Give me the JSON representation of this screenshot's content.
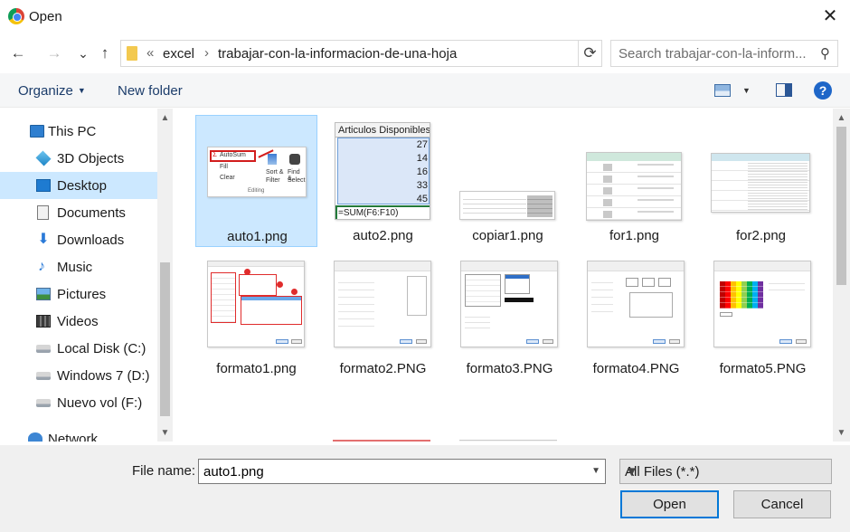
{
  "window": {
    "title": "Open",
    "close_glyph": "✕"
  },
  "nav_buttons": {
    "back": "←",
    "forward": "→",
    "recent": "⌄",
    "up": "↑"
  },
  "address": {
    "overflow": "«",
    "separator": "›",
    "crumbs": [
      "excel",
      "trabajar-con-la-informacion-de-una-hoja"
    ],
    "refresh_glyph": "⟳"
  },
  "search": {
    "placeholder": "Search trabajar-con-la-inform...",
    "icon_glyph": "⚲"
  },
  "toolbar": {
    "organize": "Organize",
    "caret": "▼",
    "new_folder": "New folder",
    "view_caret": "▼",
    "help": "?"
  },
  "sidebar": {
    "items": [
      {
        "label": "This PC",
        "icon": "computer-icon"
      },
      {
        "label": "3D Objects",
        "icon": "3d-objects-icon"
      },
      {
        "label": "Desktop",
        "icon": "desktop-icon",
        "selected": true
      },
      {
        "label": "Documents",
        "icon": "documents-icon"
      },
      {
        "label": "Downloads",
        "icon": "downloads-icon"
      },
      {
        "label": "Music",
        "icon": "music-icon"
      },
      {
        "label": "Pictures",
        "icon": "pictures-icon"
      },
      {
        "label": "Videos",
        "icon": "videos-icon"
      },
      {
        "label": "Local Disk (C:)",
        "icon": "drive-icon"
      },
      {
        "label": "Windows 7 (D:)",
        "icon": "drive-icon"
      },
      {
        "label": "Nuevo vol (F:)",
        "icon": "drive-icon"
      },
      {
        "label": "Network",
        "icon": "network-icon"
      }
    ],
    "down_glyph": "⬇",
    "music_glyph": "♪"
  },
  "scroll": {
    "up": "▲",
    "down": "▼"
  },
  "files": [
    {
      "name": "auto1.png",
      "selected": true
    },
    {
      "name": "auto2.png"
    },
    {
      "name": "copiar1.png"
    },
    {
      "name": "for1.png"
    },
    {
      "name": "for2.png"
    },
    {
      "name": "formato1.png"
    },
    {
      "name": "formato2.PNG"
    },
    {
      "name": "formato3.PNG"
    },
    {
      "name": "formato4.PNG"
    },
    {
      "name": "formato5.PNG"
    }
  ],
  "thumb_text": {
    "auto1": {
      "autosum": "AutoSum",
      "fill": "Fill",
      "clear": "Clear",
      "sort": "Sort &",
      "filter": "Filter",
      "find": "Find &",
      "select": "Select",
      "editing": "Editing",
      "sigma": "Σ"
    },
    "auto2": {
      "header": "Articulos Disponibles",
      "values": [
        "27",
        "14",
        "16",
        "33",
        "45"
      ],
      "formula": "=SUM(F6:F10)"
    }
  },
  "bottom": {
    "file_name_label": "File name:",
    "file_name_value": "auto1.png",
    "file_type": "All Files (*.*)",
    "caret": "▼",
    "open": "Open",
    "cancel": "Cancel"
  },
  "colors": {
    "selection": "#cce8ff",
    "accent": "#0078d7",
    "help": "#1e66c8"
  }
}
